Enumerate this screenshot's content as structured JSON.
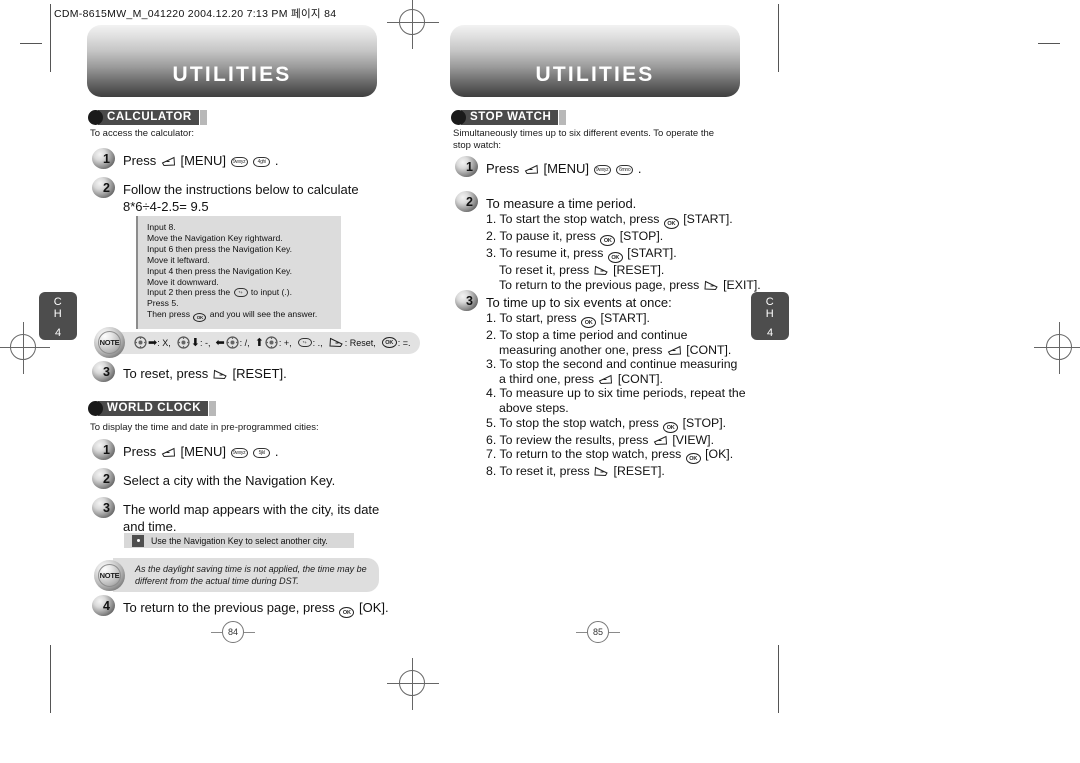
{
  "doc": {
    "header_line": "CDM-8615MW_M_041220  2004.12.20  7:13 PM  페이지 84",
    "chapter_tab": {
      "ch": "C",
      "ch2": "H",
      "number": "4"
    },
    "left_page_number": "84",
    "right_page_number": "85"
  },
  "left_page": {
    "banner_title": "UTILITIES",
    "calculator": {
      "section_label": "CALCULATOR",
      "intro": "To access the calculator:",
      "steps": [
        {
          "num": "1",
          "text_before": "Press",
          "key_menu": "[MENU]",
          "key1": "9wxyz",
          "key2": "4ghi",
          "text_after": "."
        },
        {
          "num": "2",
          "line1": "Follow the instructions below to calculate",
          "line2": "8*6÷4-2.5= 9.5"
        },
        {
          "num": "3",
          "text_before": "To reset, press",
          "key_label": "[RESET]."
        }
      ],
      "instruction_box": [
        "Input 8.",
        "Move the Navigation Key rightward.",
        "Input 6 then press the Navigation Key.",
        "Move it leftward.",
        "Input 4 then press the Navigation Key.",
        "Move it downward.",
        "Input 2 then press the  to input (.).",
        "Press 5.",
        "Then press  and you will see the answer."
      ],
      "legend": {
        "note_word": "NOTE",
        "items": [
          {
            "nav": "right",
            "op": ": X,"
          },
          {
            "nav": "down",
            "op": ": -,"
          },
          {
            "nav": "left",
            "op": ": /,"
          },
          {
            "nav": "up",
            "op": ": +,"
          },
          {
            "nav": "key-num",
            "op": ": .,"
          },
          {
            "nav": "key-soft-r",
            "op": ": Reset,"
          },
          {
            "nav": "key-ok",
            "op": ": =."
          }
        ]
      }
    },
    "world_clock": {
      "section_label": "WORLD CLOCK",
      "intro": "To display the time and date in pre-programmed cities:",
      "steps": [
        {
          "num": "1",
          "text_before": "Press",
          "key_menu": "[MENU]",
          "key1": "9wxyz",
          "key2": "5jkl",
          "text_after": "."
        },
        {
          "num": "2",
          "line1": "Select a city with the Navigation Key."
        },
        {
          "num": "3",
          "line1": "The world map appears with the city, its date",
          "line2": "and time."
        },
        {
          "num": "4",
          "text_before": "To return to the previous page, press",
          "key_label": "[OK]."
        }
      ],
      "tip": "Use the Navigation Key to select another city.",
      "note": {
        "note_word": "NOTE",
        "line1": "As the daylight saving time is not applied, the time may be",
        "line2": "different from the actual time during DST."
      }
    }
  },
  "right_page": {
    "banner_title": "UTILITIES",
    "stop_watch": {
      "section_label": "STOP WATCH",
      "intro_line1": "Simultaneously times up to six different events. To operate the",
      "intro_line2": "stop watch:",
      "step1": {
        "num": "1",
        "text_before": "Press",
        "key_menu": "[MENU]",
        "key1": "9wxyz",
        "key2": "6mno",
        "text_after": "."
      },
      "step2": {
        "num": "2",
        "title": "To measure a time period.",
        "items": [
          {
            "n": "1.",
            "pre": "To start the stop watch, press",
            "key": "ok",
            "post": "[START]."
          },
          {
            "n": "2.",
            "pre": "To pause it, press",
            "key": "ok",
            "post": "[STOP]."
          },
          {
            "n": "3.",
            "pre": "To resume it, press",
            "key": "ok",
            "post": "[START]."
          },
          {
            "n": "",
            "pre": "To reset it, press",
            "key": "soft-r",
            "post": "[RESET]."
          },
          {
            "n": "",
            "pre": "To return to the previous page, press",
            "key": "soft-r",
            "post": "[EXIT]."
          }
        ]
      },
      "step3": {
        "num": "3",
        "title": "To time up to six events at once:",
        "items": [
          {
            "n": "1.",
            "pre": "To start, press",
            "key": "ok",
            "post": "[START]."
          },
          {
            "n": "2.",
            "pre": "To stop a time period and continue",
            "key": "",
            "post": ""
          },
          {
            "n": "",
            "pre": "measuring another one, press",
            "key": "soft-l",
            "post": "[CONT]."
          },
          {
            "n": "3.",
            "pre": "To stop the second and continue measuring",
            "key": "",
            "post": ""
          },
          {
            "n": "",
            "pre": "a third one, press",
            "key": "soft-l",
            "post": "[CONT]."
          },
          {
            "n": "4.",
            "pre": "To measure up to six time periods, repeat the",
            "key": "",
            "post": ""
          },
          {
            "n": "",
            "pre": "above steps.",
            "key": "",
            "post": ""
          },
          {
            "n": "5.",
            "pre": "To stop the stop watch, press",
            "key": "ok",
            "post": "[STOP]."
          },
          {
            "n": "6.",
            "pre": "To review the results, press",
            "key": "soft-l",
            "post": "[VIEW]."
          },
          {
            "n": "7.",
            "pre": "To return to the stop watch, press",
            "key": "ok",
            "post": "[OK]."
          },
          {
            "n": "8.",
            "pre": "To reset it, press",
            "key": "soft-r",
            "post": "[RESET]."
          }
        ]
      }
    }
  }
}
